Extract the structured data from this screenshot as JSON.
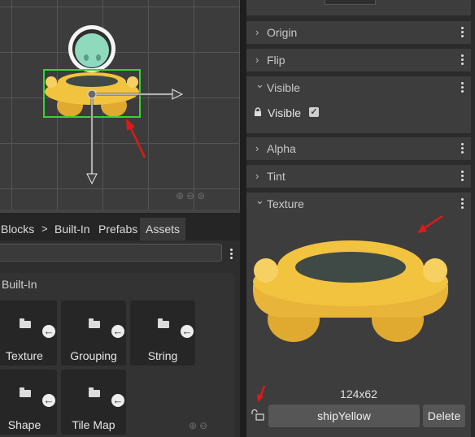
{
  "viewport": {
    "gizmo_arrows": [
      "x-axis-arrow",
      "y-axis-arrow"
    ],
    "zoom_icons": [
      "zoom-in-icon",
      "zoom-out-icon",
      "zoom-reset-icon"
    ]
  },
  "breadcrumb": {
    "items": [
      "Blocks",
      "Built-In",
      "Prefabs",
      "Assets"
    ],
    "separator": ">"
  },
  "library": {
    "section_header": "Built-In",
    "tiles": [
      {
        "label": "Texture"
      },
      {
        "label": "Grouping"
      },
      {
        "label": "String"
      },
      {
        "label": "Shape"
      },
      {
        "label": "Tile Map"
      }
    ],
    "arrow_glyph": "←"
  },
  "inspector": {
    "sections": {
      "origin": {
        "title": "Origin",
        "expanded": false
      },
      "flip": {
        "title": "Flip",
        "expanded": false
      },
      "visible": {
        "title": "Visible",
        "expanded": true
      },
      "alpha": {
        "title": "Alpha",
        "expanded": false
      },
      "tint": {
        "title": "Tint",
        "expanded": false
      },
      "texture": {
        "title": "Texture",
        "expanded": true
      }
    },
    "visible_property": {
      "label": "Visible",
      "checked": true,
      "check_glyph": "✓"
    },
    "texture": {
      "dimensions": "124x62",
      "asset_name": "shipYellow",
      "delete_label": "Delete"
    },
    "chevron_right": "›",
    "chevron_down": "⌄"
  },
  "colors": {
    "ship_body": "#f2c33f",
    "ship_shadow": "#e0a92f",
    "cockpit": "#3f4a46",
    "alien": "#8fd9bc",
    "selection": "#38d430",
    "annotation_arrow": "#e01818"
  }
}
